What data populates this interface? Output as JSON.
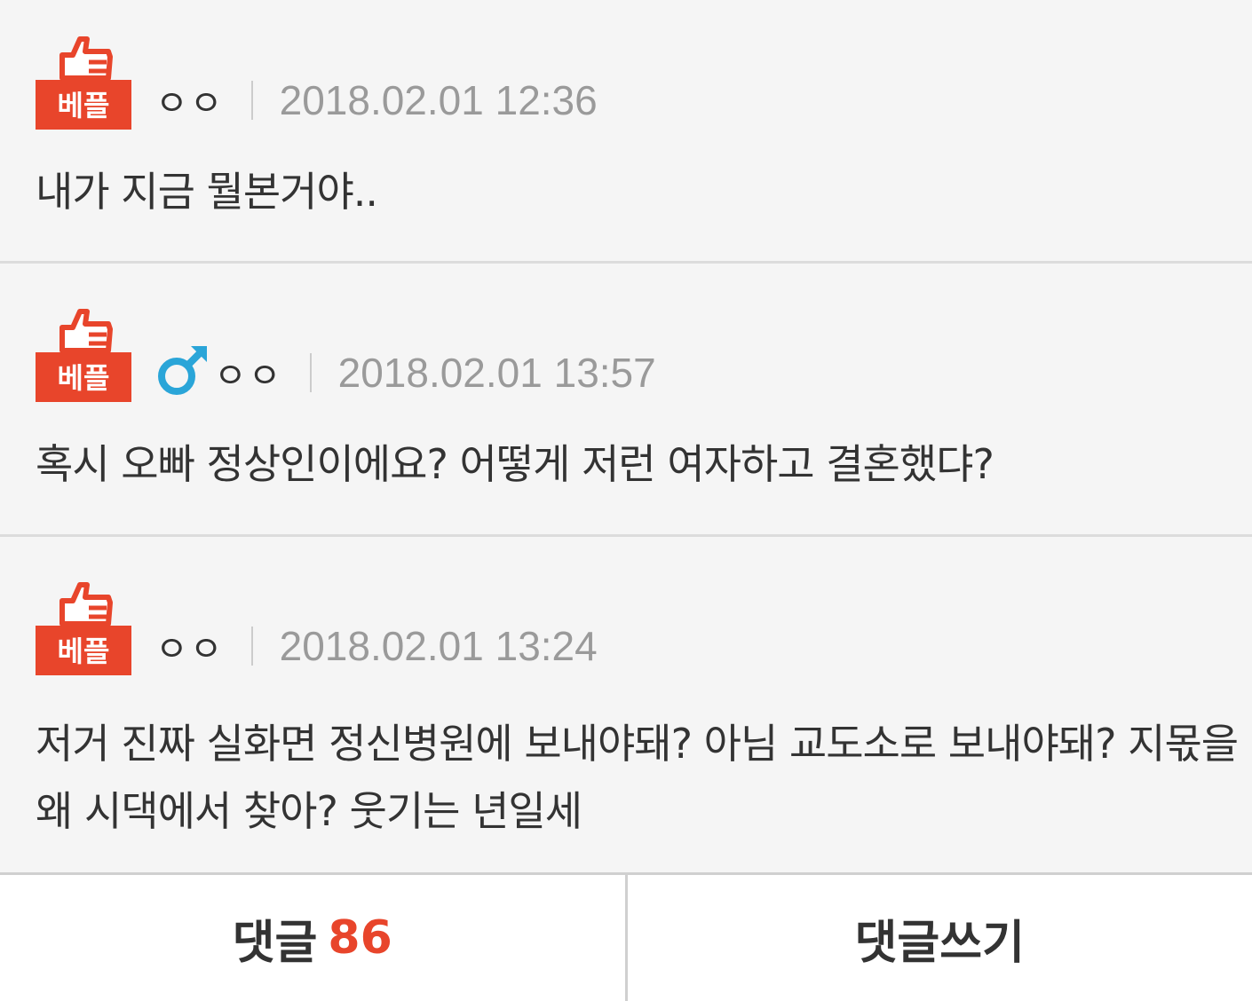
{
  "accent_color": "#e8452b",
  "badge_icon": "thumbs-up-best-reply-icon",
  "comments": [
    {
      "badge_label": "베플",
      "nickname": "ㅇㅇ",
      "gender_icon": "",
      "datetime": "2018.02.01 12:36",
      "text": "내가 지금 뭘본거야.."
    },
    {
      "badge_label": "베플",
      "nickname": "ㅇㅇ",
      "gender_icon": "male-icon",
      "datetime": "2018.02.01 13:57",
      "text": "혹시 오빠 정상인이에요? 어떻게 저런 여자하고 결혼했댜?"
    },
    {
      "badge_label": "베플",
      "nickname": "ㅇㅇ",
      "gender_icon": "",
      "datetime": "2018.02.01 13:24",
      "text": "저거 진짜 실화면 정신병원에 보내야돼? 아님 교도소로 보내야돼? 지몫을 왜 시댁에서 찾아? 웃기는 년일세"
    }
  ],
  "footer": {
    "comments_label": "댓글",
    "comments_count": "86",
    "write_label": "댓글쓰기"
  }
}
